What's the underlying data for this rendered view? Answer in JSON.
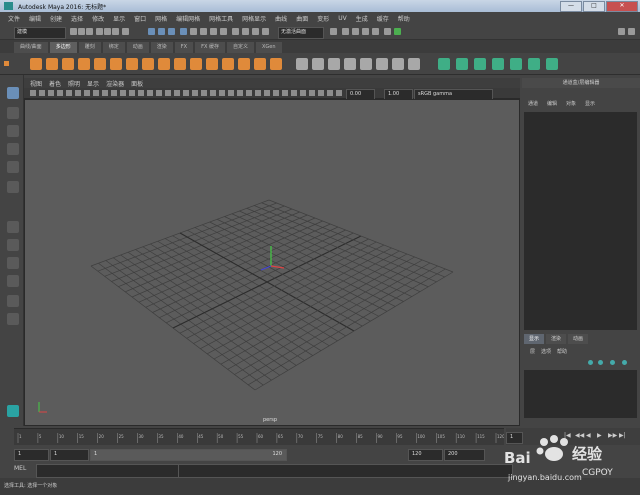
{
  "title": "Autodesk Maya 2016: 无标题*",
  "window_buttons": [
    "—",
    "□",
    "✕"
  ],
  "menus": [
    "文件",
    "编辑",
    "创建",
    "选择",
    "修改",
    "显示",
    "窗口",
    "网格",
    "编辑网格",
    "网格工具",
    "网格显示",
    "曲线",
    "曲面",
    "变形",
    "UV",
    "生成",
    "缓存",
    "帮助"
  ],
  "mode_combo": "建模",
  "live_surface": "无激活曲面",
  "shelf_tabs": [
    "曲线/曲面",
    "多边形",
    "雕刻",
    "绑定",
    "动画",
    "渲染",
    "FX",
    "FX 缓存",
    "自定义",
    "XGen"
  ],
  "selected_shelf_tab": "多边形",
  "panel_menus": [
    "视图",
    "着色",
    "照明",
    "显示",
    "渲染器",
    "面板"
  ],
  "viewport": {
    "camera_label": "persp",
    "gamma_value": "0.00",
    "exposure_value": "1.00",
    "color_space": "sRGB gamma"
  },
  "right_panel": {
    "header": "通道盒/层编辑器",
    "menus": [
      "通道",
      "编辑",
      "对象",
      "显示"
    ],
    "tabs": [
      "显示",
      "渲染",
      "动画"
    ],
    "selected_tab": "显示",
    "layer_menus": [
      "层",
      "选项",
      "帮助"
    ]
  },
  "timeline": {
    "ticks": [
      "1",
      "5",
      "10",
      "15",
      "20",
      "25",
      "30",
      "35",
      "40",
      "45",
      "50",
      "55",
      "60",
      "65",
      "70",
      "75",
      "80",
      "85",
      "90",
      "95",
      "100",
      "105",
      "110",
      "115",
      "120"
    ],
    "current": "1"
  },
  "range": {
    "start": "1",
    "start2": "1",
    "slider_start": "1",
    "slider_end": "120",
    "end": "120",
    "end2": "200"
  },
  "mel_label": "MEL",
  "status_text": "选择工具: 选择一个对象",
  "watermark": {
    "brand": "Bai",
    "brand2": "经验",
    "site": "jingyan.baidu.com",
    "user": "CGPOY"
  },
  "colors": {
    "accent_orange": "#e08a3a",
    "grid_line": "#3f3f3f",
    "viewport_bg": "#5c5c5c"
  }
}
